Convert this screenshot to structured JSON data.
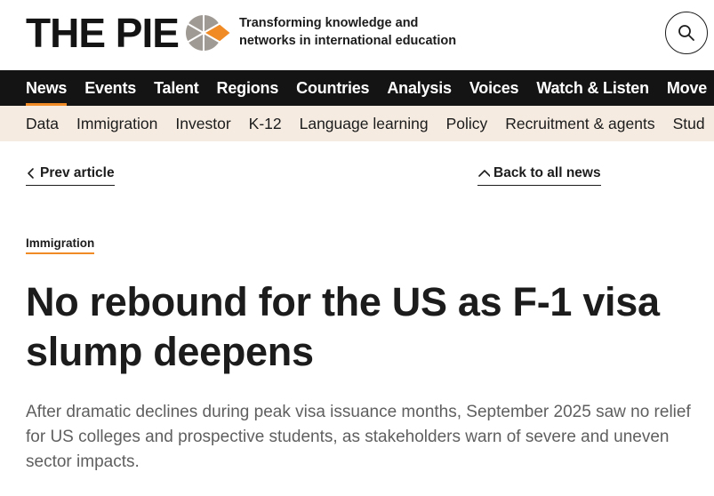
{
  "header": {
    "logo_text": "THE PIE",
    "tagline_line1": "Transforming knowledge and",
    "tagline_line2": "networks in international education",
    "search_icon": "search-icon"
  },
  "colors": {
    "accent": "#f08a24",
    "nav_bg": "#141414",
    "subnav_bg": "#f5ebe1",
    "text": "#1c1c1c",
    "standfirst": "#5f5f5f"
  },
  "nav_primary": {
    "items": [
      "News",
      "Events",
      "Talent",
      "Regions",
      "Countries",
      "Analysis",
      "Voices",
      "Watch & Listen",
      "Move"
    ],
    "active": "News"
  },
  "nav_secondary": {
    "items": [
      "Data",
      "Immigration",
      "Investor",
      "K-12",
      "Language learning",
      "Policy",
      "Recruitment & agents",
      "Stud"
    ]
  },
  "article_nav": {
    "prev_label": "Prev article",
    "back_label": "Back to all news"
  },
  "article": {
    "category": "Immigration",
    "headline": "No rebound for the US as F-1 visa slump deepens",
    "standfirst": "After dramatic declines during peak visa issuance months, September 2025 saw no relief for US colleges and prospective students, as stakeholders warn of severe and uneven sector impacts."
  }
}
